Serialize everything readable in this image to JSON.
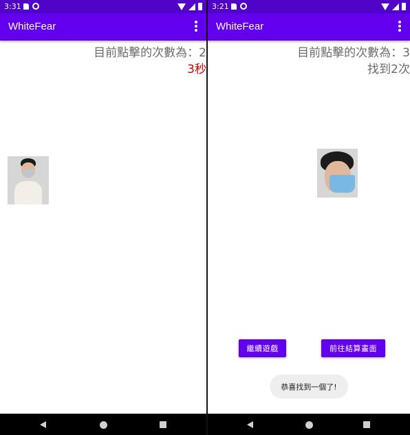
{
  "left_screen": {
    "status_time": "3:31",
    "app_title": "WhiteFear",
    "click_count_text": "目前點擊的次數為：2",
    "timer_text": "3秒"
  },
  "right_screen": {
    "status_time": "3:21",
    "app_title": "WhiteFear",
    "click_count_text": "目前點擊的次數為：3",
    "found_text": "找到2次",
    "continue_button": "繼續遊戲",
    "results_button": "前往結算畫面",
    "toast_message": "恭喜找到一個了!"
  },
  "colors": {
    "status_bar": "#4f04c8",
    "app_bar": "#6200ee",
    "button": "#6200ee",
    "timer_text": "#d00000",
    "info_text": "#6b6b6b"
  },
  "icons": {
    "status": [
      "sd-card-icon",
      "app-notification-icon",
      "wifi-icon",
      "signal-icon",
      "battery-icon"
    ],
    "appbar": [
      "overflow-menu-icon"
    ],
    "navigation": [
      "back-icon",
      "home-icon",
      "recents-icon"
    ]
  }
}
